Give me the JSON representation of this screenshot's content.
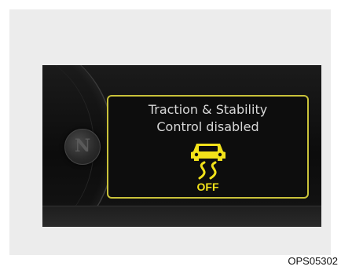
{
  "display": {
    "message_line1": "Traction & Stability",
    "message_line2": "Control disabled",
    "indicator_label": "OFF",
    "indicator_icon": "traction-control-off-icon",
    "hub_glyph": "N"
  },
  "caption": "OPS05302",
  "colors": {
    "warning_yellow": "#f2e21a",
    "frame_yellow": "#c9c23a",
    "message_text": "#d8d8d8",
    "screen_background": "#0d0d0d"
  }
}
